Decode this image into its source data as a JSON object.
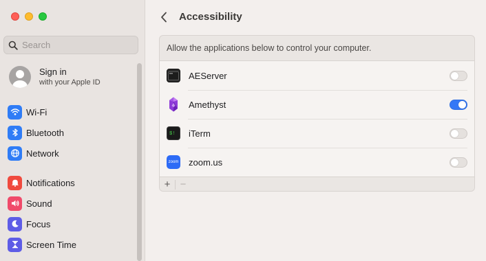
{
  "sidebar": {
    "search": {
      "placeholder": "Search",
      "value": ""
    },
    "account": {
      "title": "Sign in",
      "subtitle": "with your Apple ID"
    },
    "groups": [
      [
        {
          "label": "Wi-Fi",
          "icon": "wifi-icon",
          "color": "#2f7cf6"
        },
        {
          "label": "Bluetooth",
          "icon": "bluetooth-icon",
          "color": "#2f7cf6"
        },
        {
          "label": "Network",
          "icon": "globe-icon",
          "color": "#2f7cf6"
        }
      ],
      [
        {
          "label": "Notifications",
          "icon": "bell-icon",
          "color": "#f04a3e"
        },
        {
          "label": "Sound",
          "icon": "speaker-icon",
          "color": "#f04a6a"
        },
        {
          "label": "Focus",
          "icon": "moon-icon",
          "color": "#5e5ce6"
        },
        {
          "label": "Screen Time",
          "icon": "hourglass-icon",
          "color": "#5e5ce6"
        }
      ]
    ]
  },
  "main": {
    "title": "Accessibility",
    "description": "Allow the applications below to control your computer.",
    "apps": [
      {
        "name": "AEServer",
        "icon": "terminal-icon",
        "enabled": false
      },
      {
        "name": "Amethyst",
        "icon": "amethyst-gem-icon",
        "enabled": true
      },
      {
        "name": "iTerm",
        "icon": "iterm-icon",
        "enabled": false
      },
      {
        "name": "zoom.us",
        "icon": "zoom-icon",
        "icon_text": "zoom",
        "enabled": false
      }
    ],
    "footer": {
      "add": "+",
      "remove": "−"
    }
  },
  "colors": {
    "accent": "#3478f6"
  }
}
